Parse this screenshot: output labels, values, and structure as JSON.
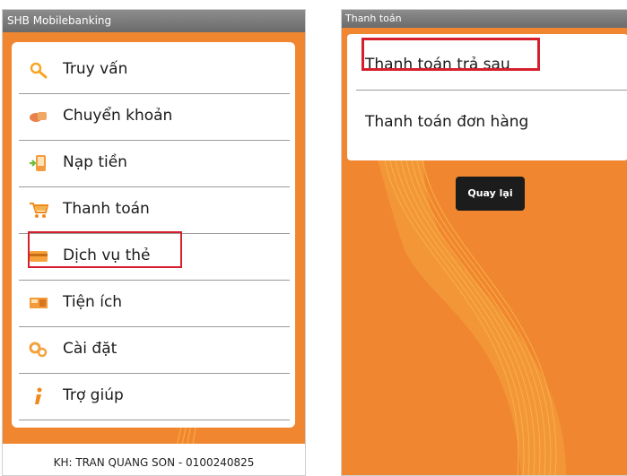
{
  "left_screen": {
    "title": "SHB Mobilebanking",
    "menu": [
      {
        "label": "Truy vấn",
        "icon": "search-icon"
      },
      {
        "label": "Chuyển khoản",
        "icon": "transfer-icon"
      },
      {
        "label": "Nạp tiền",
        "icon": "topup-icon"
      },
      {
        "label": "Thanh toán",
        "icon": "cart-icon"
      },
      {
        "label": "Dịch vụ thẻ",
        "icon": "card-icon"
      },
      {
        "label": "Tiện ích",
        "icon": "utilities-icon"
      },
      {
        "label": "Cài đặt",
        "icon": "settings-icon"
      },
      {
        "label": "Trợ giúp",
        "icon": "help-icon"
      }
    ],
    "highlighted_item": "Thanh toán",
    "footer": "KH: TRAN QUANG SON  - 0100240825"
  },
  "right_screen": {
    "title": "Thanh toán",
    "options": [
      {
        "label": "Thanh toán trả sau"
      },
      {
        "label": "Thanh toán đơn hàng"
      }
    ],
    "highlighted_option": "Thanh toán trả sau",
    "back_button": "Quay lại"
  },
  "colors": {
    "background_orange": "#f0862f",
    "highlight_red": "#d61f2c",
    "titlebar_gray": "#7a7a7a"
  }
}
